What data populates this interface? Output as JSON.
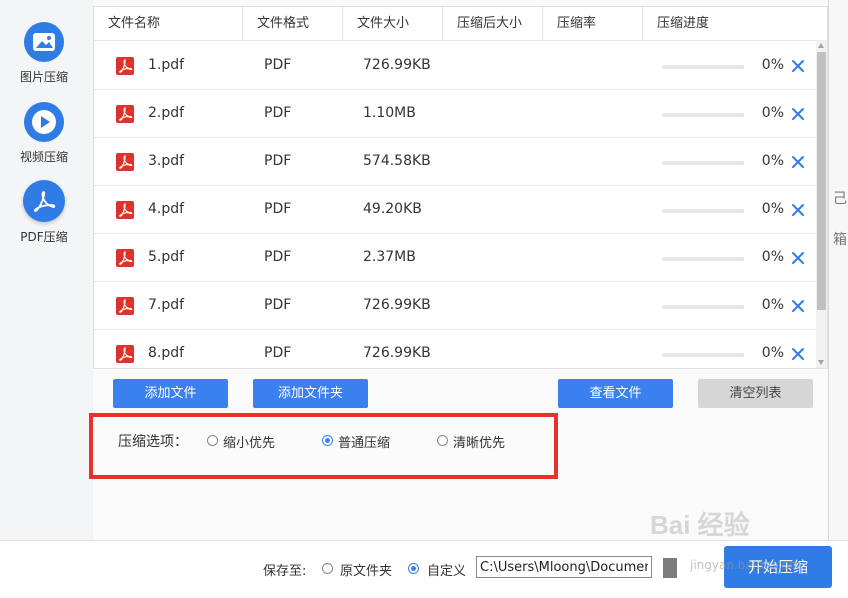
{
  "sidebar": {
    "items": [
      {
        "label": "图片压缩",
        "icon": "image-icon"
      },
      {
        "label": "视频压缩",
        "icon": "play-icon"
      },
      {
        "label": "PDF压缩",
        "icon": "pdf-icon"
      }
    ]
  },
  "table": {
    "headers": [
      "文件名称",
      "文件格式",
      "文件大小",
      "压缩后大小",
      "压缩率",
      "压缩进度"
    ],
    "rows": [
      {
        "name": "1.pdf",
        "format": "PDF",
        "size": "726.99KB",
        "progress": "0%"
      },
      {
        "name": "2.pdf",
        "format": "PDF",
        "size": "1.10MB",
        "progress": "0%"
      },
      {
        "name": "3.pdf",
        "format": "PDF",
        "size": "574.58KB",
        "progress": "0%"
      },
      {
        "name": "4.pdf",
        "format": "PDF",
        "size": "49.20KB",
        "progress": "0%"
      },
      {
        "name": "5.pdf",
        "format": "PDF",
        "size": "2.37MB",
        "progress": "0%"
      },
      {
        "name": "7.pdf",
        "format": "PDF",
        "size": "726.99KB",
        "progress": "0%"
      },
      {
        "name": "8.pdf",
        "format": "PDF",
        "size": "726.99KB",
        "progress": "0%"
      }
    ]
  },
  "actions": {
    "add_file": "添加文件",
    "add_folder": "添加文件夹",
    "view_files": "查看文件",
    "clear_list": "清空列表"
  },
  "options": {
    "label": "压缩选项：",
    "choices": [
      "缩小优先",
      "普通压缩",
      "清晰优先"
    ],
    "selected": "普通压缩"
  },
  "save": {
    "label": "保存至:",
    "choices": [
      "原文件夹",
      "自定义"
    ],
    "selected": "自定义",
    "path": "C:\\Users\\Mloong\\Documents"
  },
  "start_button": "开始压缩",
  "right_strip_chars": [
    "己",
    "箱"
  ],
  "watermark": {
    "main": "Bai 经验",
    "sub": "jingyan.baidu.com"
  },
  "colors": {
    "accent": "#2f7ce6",
    "highlight": "#e8312f",
    "pdf_red": "#e0322b"
  }
}
